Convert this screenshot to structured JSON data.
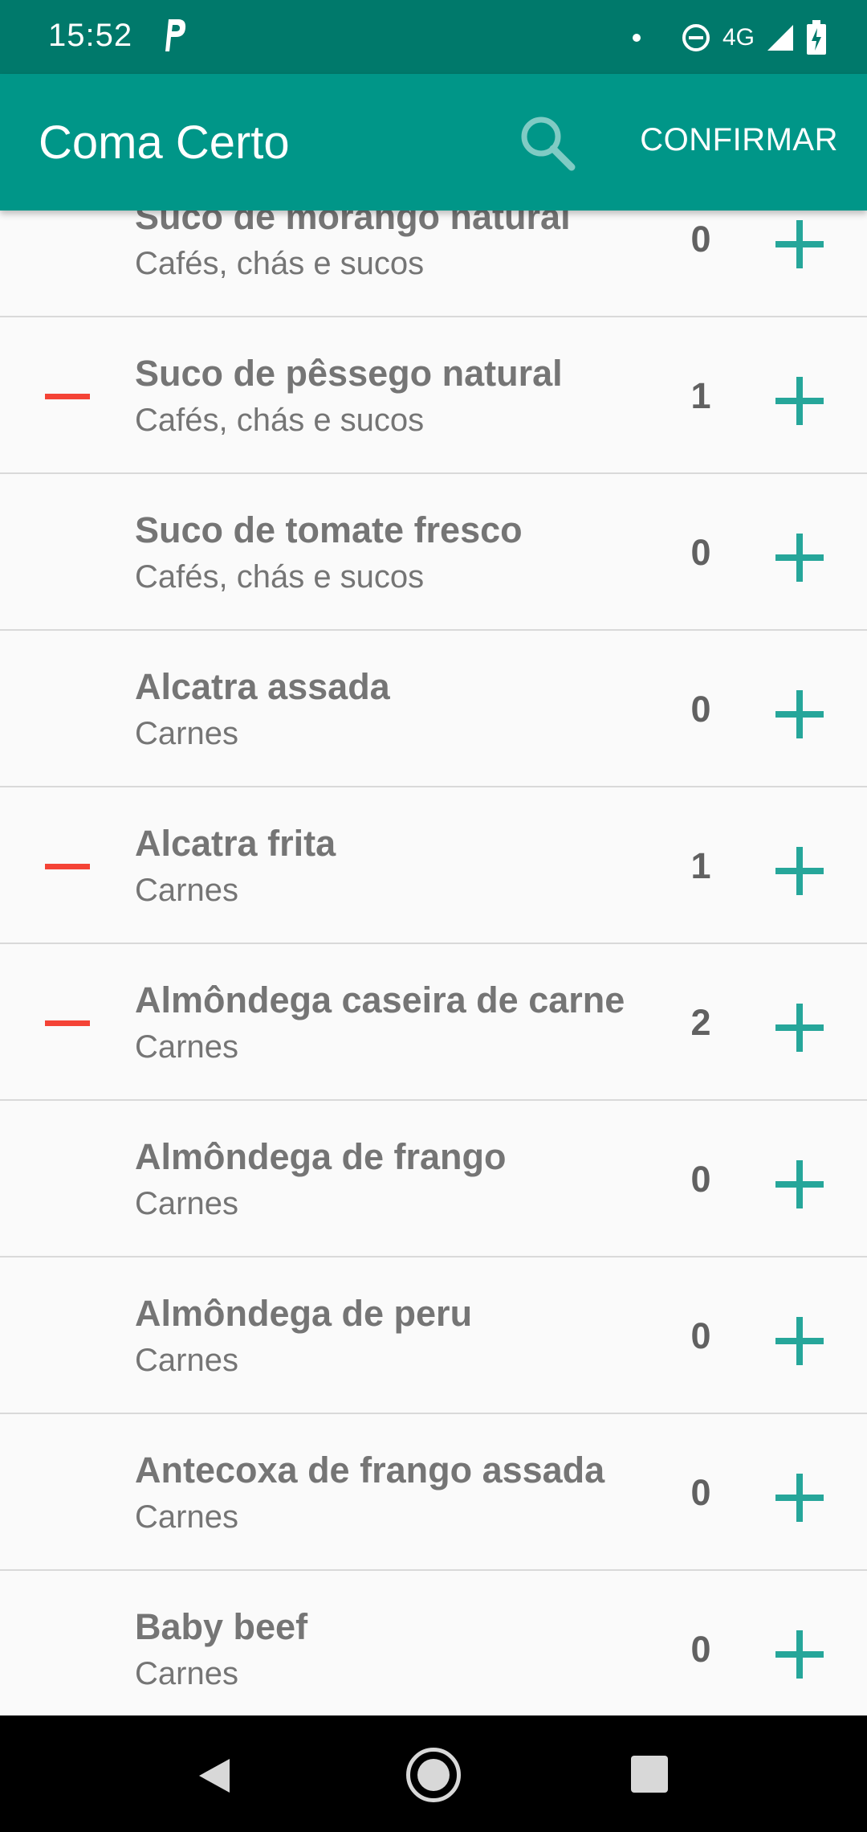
{
  "status_bar": {
    "time": "15:52",
    "network": "4G"
  },
  "app_bar": {
    "title": "Coma Certo",
    "confirm_label": "CONFIRMAR"
  },
  "colors": {
    "status_bar": "#00796b",
    "app_bar": "#009688",
    "plus": "#26a69a",
    "minus": "#f44336",
    "text": "#757575"
  },
  "items": [
    {
      "name": "Suco de morango natural",
      "category": "Cafés, chás e sucos",
      "count": "0",
      "show_minus": false
    },
    {
      "name": "Suco de pêssego natural",
      "category": "Cafés, chás e sucos",
      "count": "1",
      "show_minus": true
    },
    {
      "name": "Suco de tomate fresco",
      "category": "Cafés, chás e sucos",
      "count": "0",
      "show_minus": false
    },
    {
      "name": "Alcatra assada",
      "category": "Carnes",
      "count": "0",
      "show_minus": false
    },
    {
      "name": "Alcatra frita",
      "category": "Carnes",
      "count": "1",
      "show_minus": true
    },
    {
      "name": "Almôndega caseira de carne",
      "category": "Carnes",
      "count": "2",
      "show_minus": true
    },
    {
      "name": "Almôndega de frango",
      "category": "Carnes",
      "count": "0",
      "show_minus": false
    },
    {
      "name": "Almôndega de peru",
      "category": "Carnes",
      "count": "0",
      "show_minus": false
    },
    {
      "name": "Antecoxa de frango assada",
      "category": "Carnes",
      "count": "0",
      "show_minus": false
    },
    {
      "name": "Baby beef",
      "category": "Carnes",
      "count": "0",
      "show_minus": false
    }
  ]
}
